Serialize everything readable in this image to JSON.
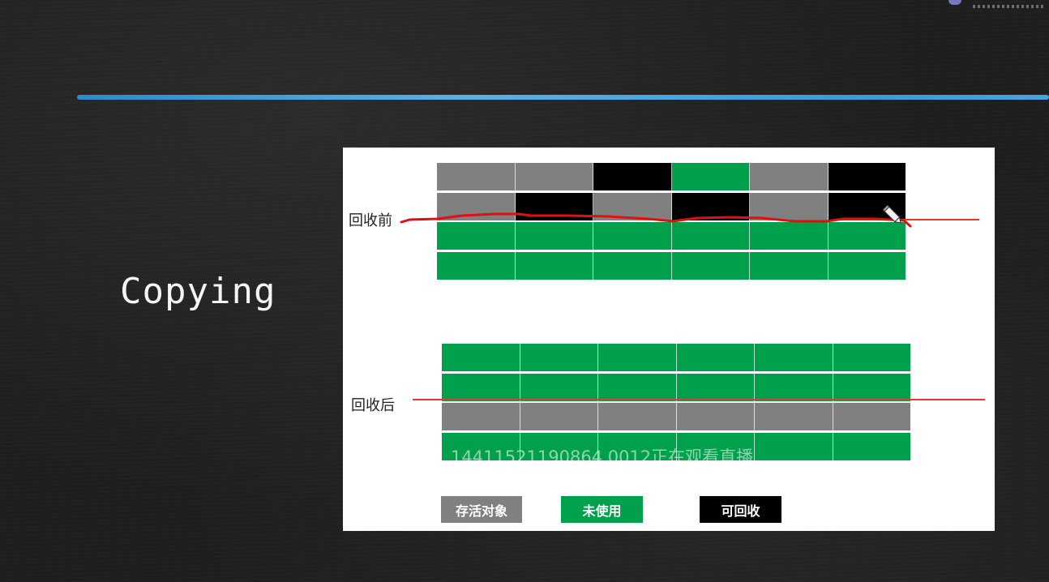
{
  "slide": {
    "title": "Copying"
  },
  "diagram": {
    "before": {
      "label": "回收前",
      "rows": [
        [
          "gray",
          "gray",
          "black",
          "green",
          "gray",
          "black"
        ],
        [
          "gray",
          "black",
          "gray",
          "black",
          "gray",
          "black"
        ],
        [
          "green",
          "green",
          "green",
          "green",
          "green",
          "green"
        ],
        [
          "green",
          "green",
          "green",
          "green",
          "green",
          "green"
        ]
      ]
    },
    "after": {
      "label": "回收后",
      "rows": [
        [
          "green",
          "green",
          "green",
          "green",
          "green",
          "green"
        ],
        [
          "green",
          "green",
          "green",
          "green",
          "green",
          "green"
        ],
        [
          "gray",
          "gray",
          "gray",
          "gray",
          "gray",
          "gray"
        ],
        [
          "green",
          "green",
          "green",
          "green",
          "green",
          "green"
        ]
      ]
    },
    "legend": [
      {
        "label": "存活对象",
        "color": "gray"
      },
      {
        "label": "未使用",
        "color": "green"
      },
      {
        "label": "可回收",
        "color": "black"
      }
    ],
    "colors": {
      "gray": "#808080",
      "green": "#00a04d",
      "black": "#000000",
      "divider_line": "#e53a2e",
      "annotation": "#e01010",
      "chalk_line": "#3aa0e6"
    }
  },
  "overlay": {
    "watermark": "14411521190864 0012正在观看直播",
    "pencil_icon": "pencil-icon"
  }
}
